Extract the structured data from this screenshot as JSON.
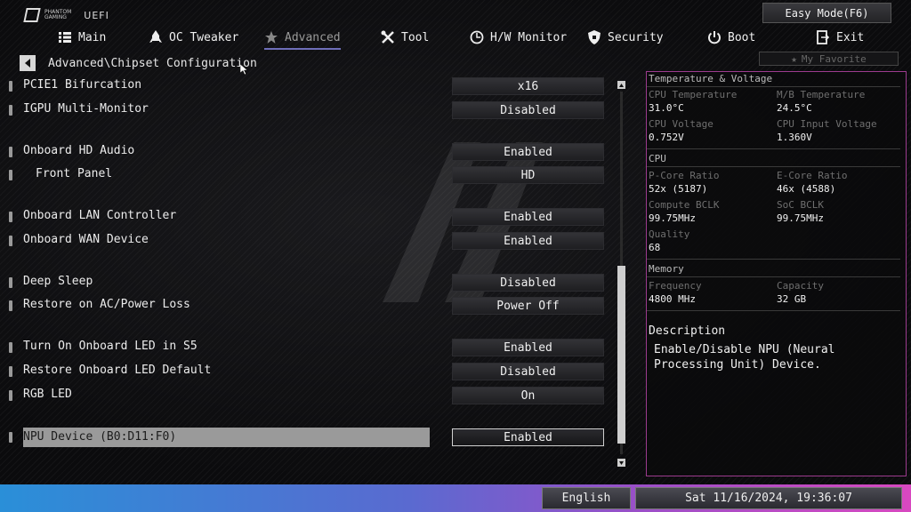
{
  "header": {
    "brand_line1": "PHANTOM",
    "brand_line2": "GAMING",
    "uefi": "UEFI",
    "easy_mode": "Easy Mode(F6)"
  },
  "nav": {
    "main": "Main",
    "oc_tweaker": "OC Tweaker",
    "advanced": "Advanced",
    "tool": "Tool",
    "hw_monitor": "H/W Monitor",
    "security": "Security",
    "boot": "Boot",
    "exit": "Exit",
    "active": "advanced"
  },
  "favorite": "My Favorite",
  "breadcrumb": "Advanced\\Chipset Configuration",
  "settings": [
    {
      "label": "PCIE1 Bifurcation",
      "value": "x16"
    },
    {
      "label": "IGPU Multi-Monitor",
      "value": "Disabled"
    },
    {
      "label": "Onboard HD Audio",
      "value": "Enabled"
    },
    {
      "label": "Front Panel",
      "value": "HD"
    },
    {
      "label": "Onboard LAN Controller",
      "value": "Enabled"
    },
    {
      "label": "Onboard WAN Device",
      "value": "Enabled"
    },
    {
      "label": "Deep Sleep",
      "value": "Disabled"
    },
    {
      "label": "Restore on AC/Power Loss",
      "value": "Power Off"
    },
    {
      "label": "Turn On Onboard LED in S5",
      "value": "Enabled"
    },
    {
      "label": "Restore Onboard LED Default",
      "value": "Disabled"
    },
    {
      "label": "RGB LED",
      "value": "On"
    },
    {
      "label": "NPU Device (B0:D11:F0)",
      "value": "Enabled",
      "selected": true
    }
  ],
  "panel": {
    "temp_title": "Temperature & Voltage",
    "cpu_temp_label": "CPU Temperature",
    "cpu_temp": "31.0°C",
    "mb_temp_label": "M/B Temperature",
    "mb_temp": "24.5°C",
    "cpu_volt_label": "CPU Voltage",
    "cpu_volt": "0.752V",
    "cpu_in_volt_label": "CPU Input Voltage",
    "cpu_in_volt": "1.360V",
    "cpu_title": "CPU",
    "pcore_label": "P-Core Ratio",
    "pcore": "52x (5187)",
    "ecore_label": "E-Core Ratio",
    "ecore": "46x (4588)",
    "compute_bclk_label": "Compute BCLK",
    "compute_bclk": "99.75MHz",
    "soc_bclk_label": "SoC BCLK",
    "soc_bclk": "99.75MHz",
    "quality_label": "Quality",
    "quality": "68",
    "memory_title": "Memory",
    "freq_label": "Frequency",
    "freq": "4800 MHz",
    "capacity_label": "Capacity",
    "capacity": "32 GB",
    "desc_title": "Description",
    "desc_text": "Enable/Disable NPU (Neural Processing Unit) Device."
  },
  "footer": {
    "language": "English",
    "datetime": "Sat 11/16/2024, 19:36:07"
  }
}
